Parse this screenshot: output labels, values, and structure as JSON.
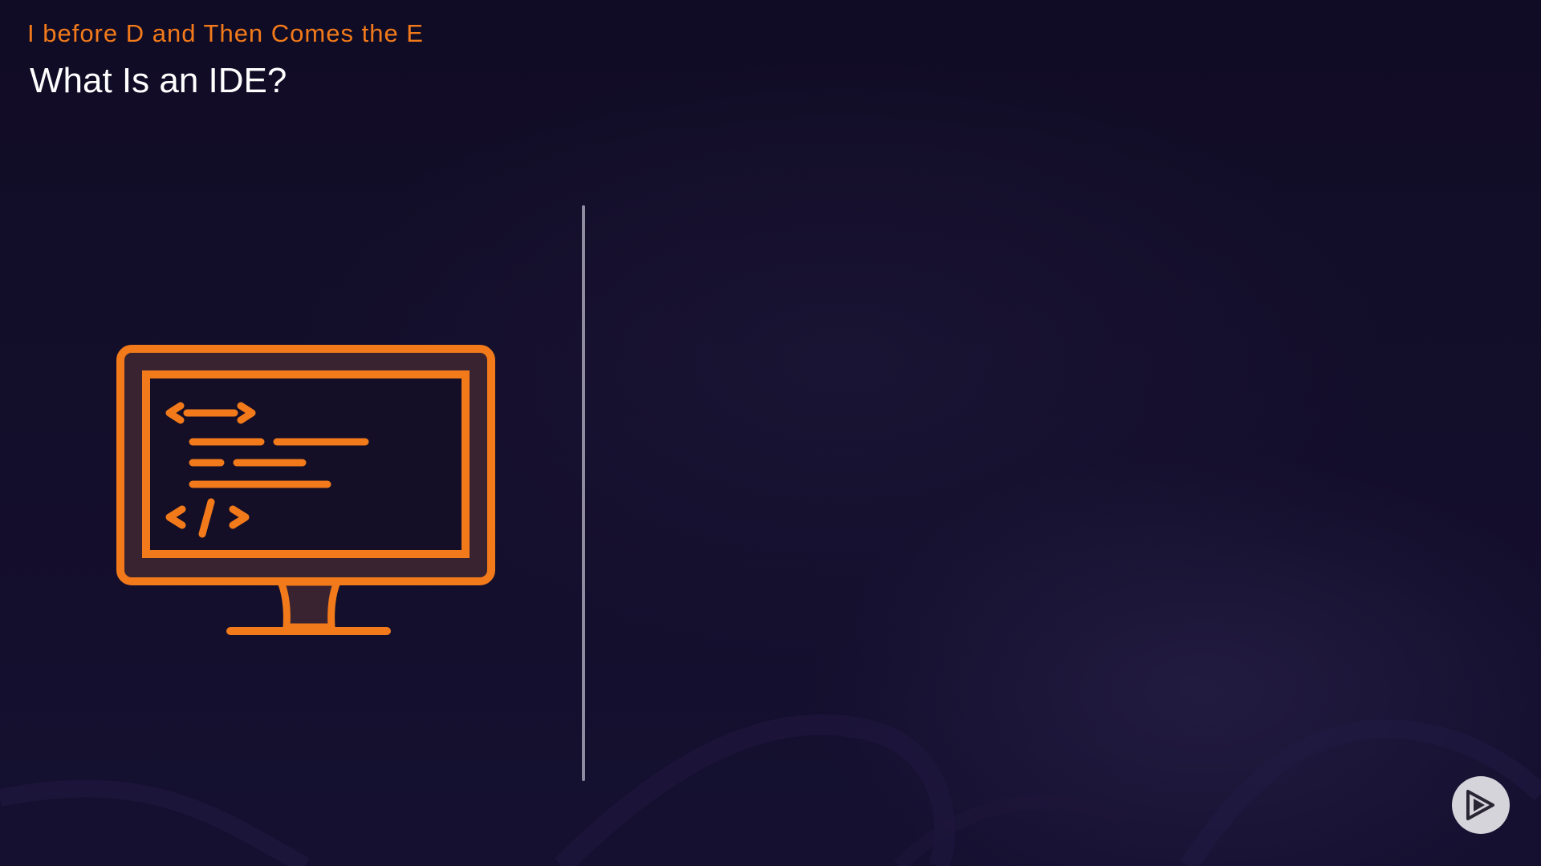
{
  "slide": {
    "eyebrow": "I before D and Then Comes the E",
    "title": "What Is an IDE?"
  },
  "icons": {
    "illustration": "computer-monitor-code-icon",
    "brand": "play-logo-icon"
  },
  "colors": {
    "background": "#120d26",
    "accent": "#f27a1a",
    "title_text": "#ffffff",
    "divider": "#8f8ca1",
    "badge": "#d4d4da"
  }
}
